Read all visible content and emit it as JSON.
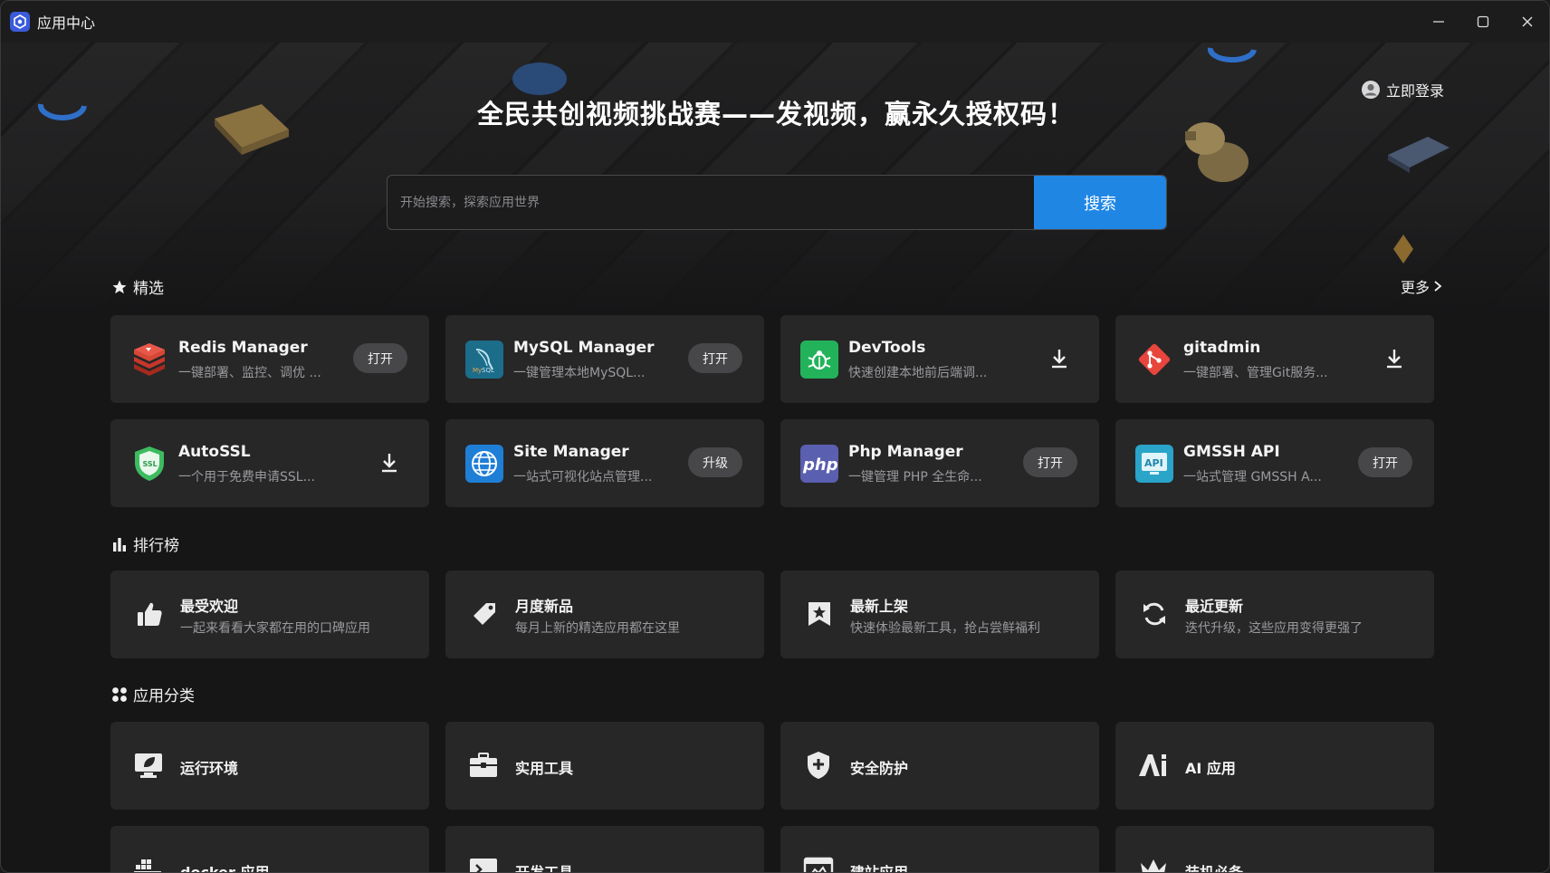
{
  "window": {
    "title": "应用中心"
  },
  "header": {
    "banner_title": "全民共创视频挑战赛——发视频，赢永久授权码！",
    "login_label": "立即登录"
  },
  "search": {
    "placeholder": "开始搜索，探索应用世界",
    "button_label": "搜索"
  },
  "featured": {
    "title": "精选",
    "more_label": "更多",
    "apps": [
      {
        "name": "Redis Manager",
        "desc": "一键部署、监控、调优 ...",
        "action": "打开",
        "icon": "redis-icon",
        "color": "#d33a2c"
      },
      {
        "name": "MySQL Manager",
        "desc": "一键管理本地MySQL...",
        "action": "打开",
        "icon": "mysql-icon",
        "color": "#1c6d8a"
      },
      {
        "name": "DevTools",
        "desc": "快速创建本地前后端调...",
        "action": "download",
        "icon": "devtools-icon",
        "color": "#22b35a"
      },
      {
        "name": "gitadmin",
        "desc": "一键部署、管理Git服务...",
        "action": "download",
        "icon": "git-icon",
        "color": "#e8453c"
      },
      {
        "name": "AutoSSL",
        "desc": "一个用于免费申请SSL...",
        "action": "download",
        "icon": "ssl-shield-icon",
        "color": "#3dbb5f"
      },
      {
        "name": "Site Manager",
        "desc": "一站式可视化站点管理...",
        "action": "升级",
        "icon": "globe-icon",
        "color": "#1f7fd6"
      },
      {
        "name": "Php Manager",
        "desc": "一键管理 PHP 全生命...",
        "action": "打开",
        "icon": "php-icon",
        "color": "#5a5fb0"
      },
      {
        "name": "GMSSH API",
        "desc": "一站式管理 GMSSH A...",
        "action": "打开",
        "icon": "api-icon",
        "color": "#2aa4c9"
      }
    ]
  },
  "ranking": {
    "title": "排行榜",
    "items": [
      {
        "title": "最受欢迎",
        "desc": "一起来看看大家都在用的口碑应用",
        "icon": "thumbs-up-icon"
      },
      {
        "title": "月度新品",
        "desc": "每月上新的精选应用都在这里",
        "icon": "tag-icon"
      },
      {
        "title": "最新上架",
        "desc": "快速体验最新工具，抢占尝鲜福利",
        "icon": "star-badge-icon"
      },
      {
        "title": "最近更新",
        "desc": "迭代升级，这些应用变得更强了",
        "icon": "refresh-icon"
      }
    ]
  },
  "categories": {
    "title": "应用分类",
    "items": [
      {
        "label": "运行环境",
        "icon": "monitor-leaf-icon"
      },
      {
        "label": "实用工具",
        "icon": "toolbox-icon"
      },
      {
        "label": "安全防护",
        "icon": "shield-plus-icon"
      },
      {
        "label": "AI 应用",
        "icon": "ai-icon"
      },
      {
        "label": "docker 应用",
        "icon": "docker-icon"
      },
      {
        "label": "开发工具",
        "icon": "terminal-icon"
      },
      {
        "label": "建站应用",
        "icon": "website-icon"
      },
      {
        "label": "装机必备",
        "icon": "crown-icon"
      }
    ]
  }
}
